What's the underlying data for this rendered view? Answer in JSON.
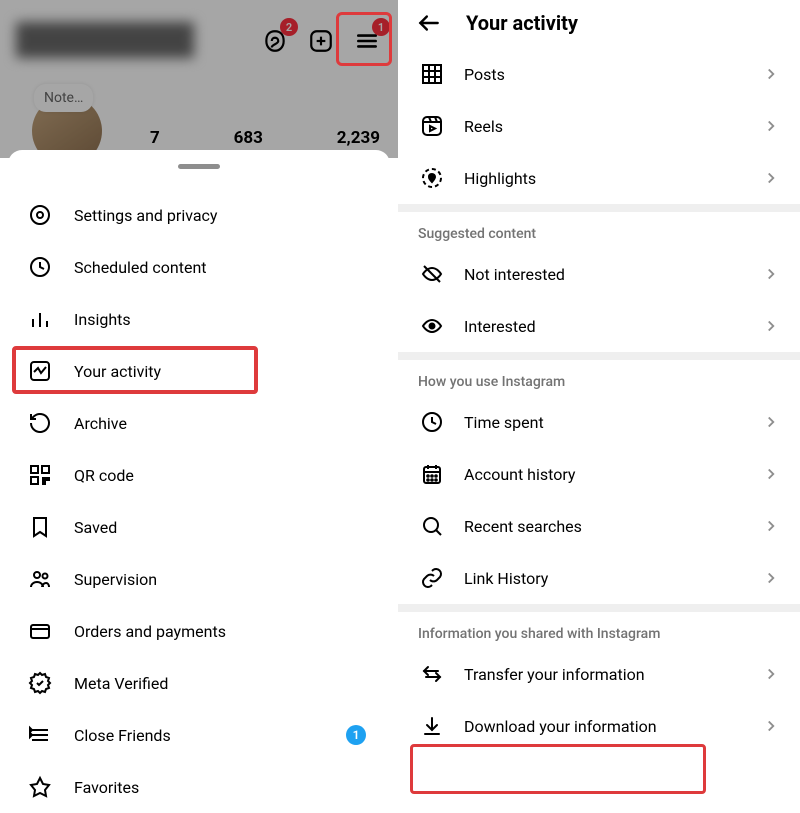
{
  "left": {
    "threads_badge": "2",
    "hamburger_badge": "1",
    "note_label": "Note…",
    "stats": {
      "posts": "7",
      "followers": "683",
      "following": "2,239"
    },
    "menu": {
      "settings": "Settings and privacy",
      "scheduled": "Scheduled content",
      "insights": "Insights",
      "activity": "Your activity",
      "archive": "Archive",
      "qr": "QR code",
      "saved": "Saved",
      "supervision": "Supervision",
      "orders": "Orders and payments",
      "meta": "Meta Verified",
      "close_friends": "Close Friends",
      "close_friends_badge": "1",
      "favorites": "Favorites"
    }
  },
  "right": {
    "title": "Your activity",
    "posts": "Posts",
    "reels": "Reels",
    "highlights": "Highlights",
    "sec_suggested": "Suggested content",
    "not_interested": "Not interested",
    "interested": "Interested",
    "sec_how": "How you use Instagram",
    "time_spent": "Time spent",
    "account_history": "Account history",
    "recent_searches": "Recent searches",
    "link_history": "Link History",
    "sec_info": "Information you shared with Instagram",
    "transfer": "Transfer your information",
    "download": "Download your information"
  }
}
